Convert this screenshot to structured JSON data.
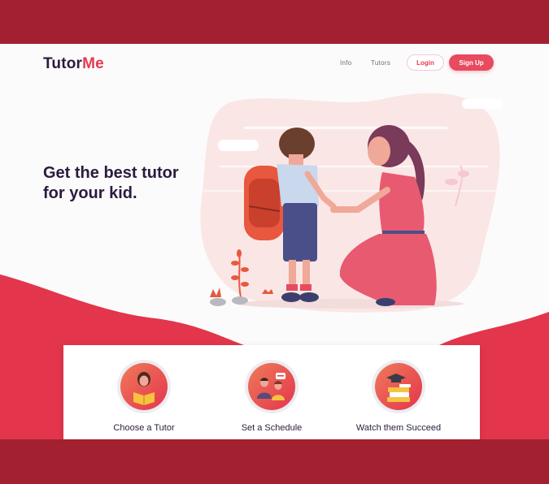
{
  "header": {
    "logo_primary": "Tutor",
    "logo_accent": "Me",
    "nav": [
      {
        "label": "Info"
      },
      {
        "label": "Tutors"
      }
    ],
    "login_label": "Login",
    "signup_label": "Sign Up"
  },
  "hero": {
    "headline_line1": "Get the best tutor",
    "headline_line2": "for your kid."
  },
  "steps": [
    {
      "label": "Choose a Tutor",
      "icon": "tutor-reading-icon"
    },
    {
      "label": "Set a Schedule",
      "icon": "schedule-meeting-icon"
    },
    {
      "label": "Watch them Succeed",
      "icon": "graduation-books-icon"
    }
  ],
  "colors": {
    "brand_dark": "#2c1b3e",
    "accent": "#e53b52",
    "frame": "#a32030",
    "wave": "#e3354c"
  }
}
